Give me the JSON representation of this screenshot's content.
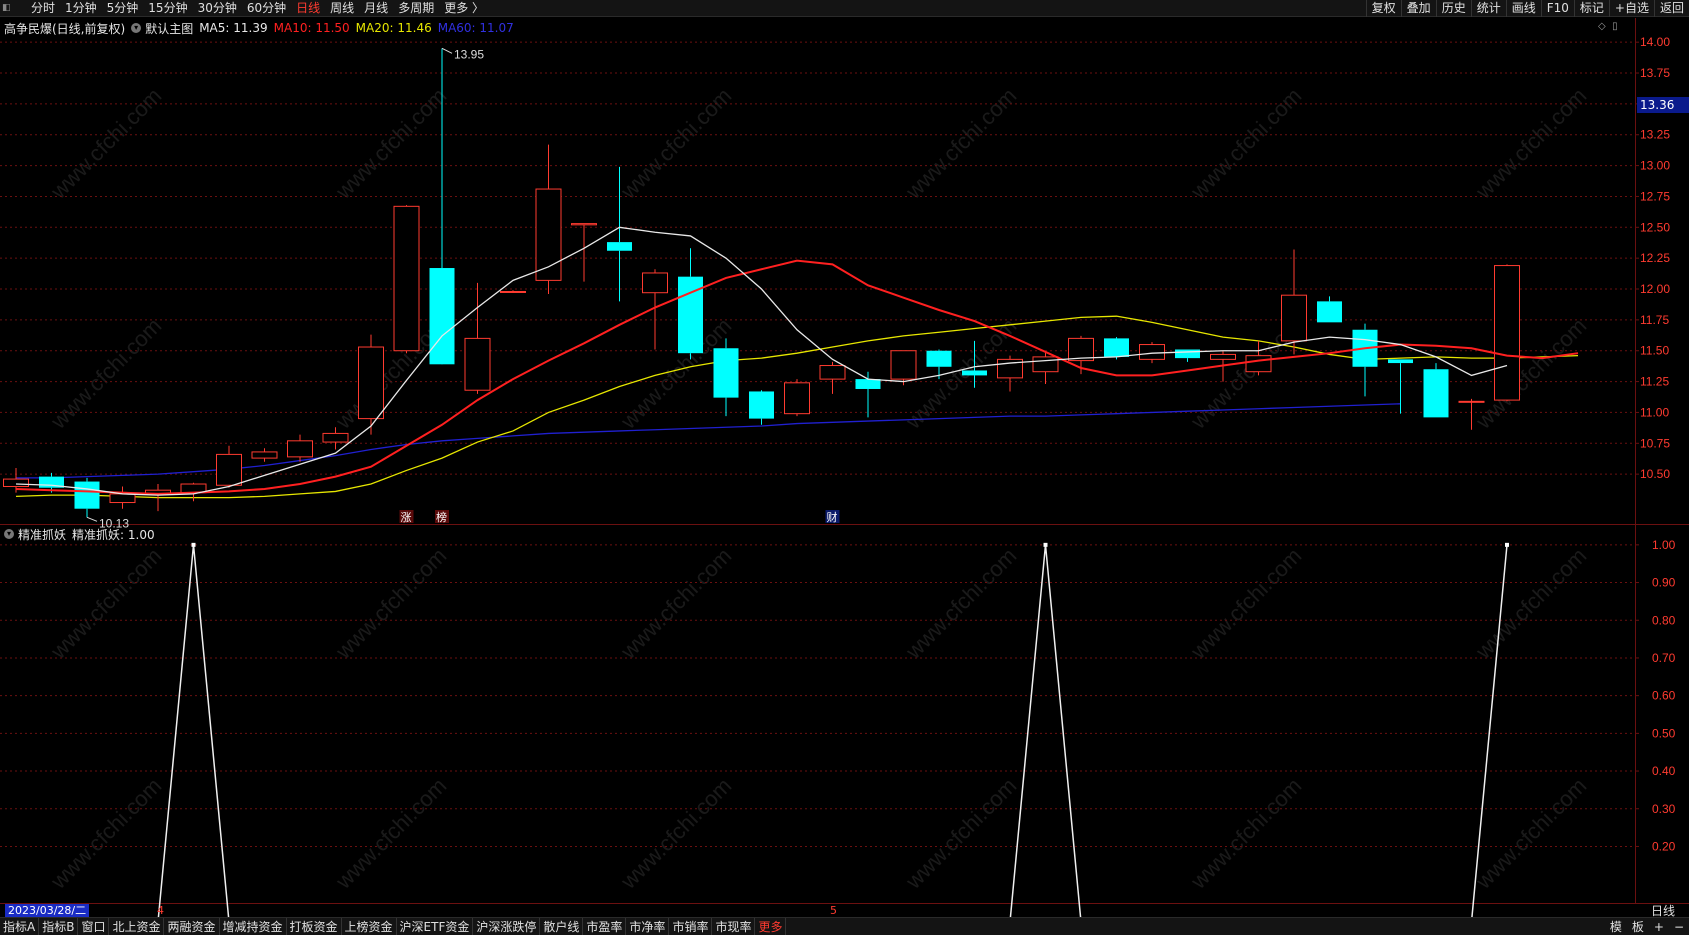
{
  "toolbar": {
    "periods": [
      "分时",
      "1分钟",
      "5分钟",
      "15分钟",
      "30分钟",
      "60分钟",
      "日线",
      "周线",
      "月线",
      "多周期",
      "更多 〉"
    ],
    "active_period_index": 6,
    "right_tools": [
      "复权",
      "叠加",
      "历史",
      "统计",
      "画线",
      "F10",
      "标记",
      "+自选",
      "返回"
    ]
  },
  "legend": {
    "stock": "高争民爆(日线,前复权)",
    "main_chart": "默认主图",
    "ma5": "MA5: 11.39",
    "ma10": "MA10: 11.50",
    "ma20": "MA20: 11.46",
    "ma60": "MA60: 11.07"
  },
  "colors": {
    "up": "#ff3b30",
    "down": "#00ffff",
    "ma5": "#e8e8e8",
    "ma10": "#ff2020",
    "ma20": "#e6e600",
    "ma60": "#2020d0",
    "grid": "#6b1010"
  },
  "price_axis": {
    "ticks": [
      "14.00",
      "13.75",
      "13.50",
      "13.25",
      "13.00",
      "12.75",
      "12.50",
      "12.25",
      "12.00",
      "11.75",
      "11.50",
      "11.25",
      "11.00",
      "10.75",
      "10.50"
    ],
    "current_price": "13.36",
    "high_label": "13.95",
    "low_label": "10.13"
  },
  "events": [
    "涨",
    "榜",
    "财"
  ],
  "indicator": {
    "name": "精准抓妖",
    "value_label": "精准抓妖: 1.00",
    "ticks": [
      "1.00",
      "0.90",
      "0.80",
      "0.70",
      "0.60",
      "0.50",
      "0.40",
      "0.30",
      "0.20"
    ]
  },
  "date_bar": {
    "selected_date": "2023/03/28/二",
    "month_marks": [
      "4",
      "5"
    ],
    "period_label": "日线"
  },
  "bottom_tabs": [
    "指标A",
    "指标B",
    "窗口",
    "北上资金",
    "两融资金",
    "增减持资金",
    "打板资金",
    "上榜资金",
    "沪深ETF资金",
    "沪深涨跌停",
    "散户线",
    "市盈率",
    "市净率",
    "市销率",
    "市现率",
    "更多"
  ],
  "bottom_right": [
    "模",
    "板",
    "+",
    "−"
  ],
  "chart_data": {
    "type": "candlestick",
    "candles": [
      {
        "o": 10.4,
        "h": 10.55,
        "l": 10.35,
        "c": 10.46
      },
      {
        "o": 10.48,
        "h": 10.51,
        "l": 10.35,
        "c": 10.39
      },
      {
        "o": 10.44,
        "h": 10.47,
        "l": 10.15,
        "c": 10.22
      },
      {
        "o": 10.27,
        "h": 10.4,
        "l": 10.22,
        "c": 10.34
      },
      {
        "o": 10.34,
        "h": 10.42,
        "l": 10.2,
        "c": 10.37
      },
      {
        "o": 10.35,
        "h": 10.43,
        "l": 10.28,
        "c": 10.42
      },
      {
        "o": 10.41,
        "h": 10.73,
        "l": 10.39,
        "c": 10.66
      },
      {
        "o": 10.63,
        "h": 10.71,
        "l": 10.6,
        "c": 10.68
      },
      {
        "o": 10.64,
        "h": 10.82,
        "l": 10.6,
        "c": 10.77
      },
      {
        "o": 10.76,
        "h": 10.88,
        "l": 10.7,
        "c": 10.83
      },
      {
        "o": 10.95,
        "h": 11.63,
        "l": 10.82,
        "c": 11.53
      },
      {
        "o": 11.5,
        "h": 12.68,
        "l": 11.48,
        "c": 12.67
      },
      {
        "o": 12.17,
        "h": 13.95,
        "l": 11.7,
        "c": 11.39
      },
      {
        "o": 11.18,
        "h": 12.05,
        "l": 11.15,
        "c": 11.6
      },
      {
        "o": 11.98,
        "h": 11.99,
        "l": 11.98,
        "c": 11.98
      },
      {
        "o": 12.07,
        "h": 13.17,
        "l": 11.96,
        "c": 12.81
      },
      {
        "o": 12.52,
        "h": 12.53,
        "l": 12.06,
        "c": 12.53
      },
      {
        "o": 12.38,
        "h": 12.99,
        "l": 11.9,
        "c": 12.31
      },
      {
        "o": 11.97,
        "h": 12.16,
        "l": 11.51,
        "c": 12.13
      },
      {
        "o": 12.1,
        "h": 12.33,
        "l": 11.43,
        "c": 11.48
      },
      {
        "o": 11.52,
        "h": 11.6,
        "l": 10.97,
        "c": 11.12
      },
      {
        "o": 11.17,
        "h": 11.18,
        "l": 10.9,
        "c": 10.95
      },
      {
        "o": 10.99,
        "h": 11.27,
        "l": 10.97,
        "c": 11.24
      },
      {
        "o": 11.27,
        "h": 11.41,
        "l": 11.15,
        "c": 11.38
      },
      {
        "o": 11.27,
        "h": 11.33,
        "l": 10.96,
        "c": 11.19
      },
      {
        "o": 11.27,
        "h": 11.49,
        "l": 11.22,
        "c": 11.5
      },
      {
        "o": 11.5,
        "h": 11.51,
        "l": 11.27,
        "c": 11.37
      },
      {
        "o": 11.34,
        "h": 11.58,
        "l": 11.2,
        "c": 11.3
      },
      {
        "o": 11.28,
        "h": 11.46,
        "l": 11.17,
        "c": 11.43
      },
      {
        "o": 11.33,
        "h": 11.49,
        "l": 11.23,
        "c": 11.45
      },
      {
        "o": 11.42,
        "h": 11.62,
        "l": 11.31,
        "c": 11.6
      },
      {
        "o": 11.6,
        "h": 11.61,
        "l": 11.43,
        "c": 11.45
      },
      {
        "o": 11.43,
        "h": 11.57,
        "l": 11.4,
        "c": 11.55
      },
      {
        "o": 11.51,
        "h": 11.51,
        "l": 11.41,
        "c": 11.44
      },
      {
        "o": 11.43,
        "h": 11.5,
        "l": 11.25,
        "c": 11.47
      },
      {
        "o": 11.33,
        "h": 11.58,
        "l": 11.3,
        "c": 11.46
      },
      {
        "o": 11.58,
        "h": 12.32,
        "l": 11.47,
        "c": 11.95
      },
      {
        "o": 11.9,
        "h": 11.94,
        "l": 11.73,
        "c": 11.73
      },
      {
        "o": 11.67,
        "h": 11.72,
        "l": 11.13,
        "c": 11.37
      },
      {
        "o": 11.43,
        "h": 11.43,
        "l": 10.99,
        "c": 11.4
      },
      {
        "o": 11.35,
        "h": 11.4,
        "l": 10.96,
        "c": 10.96
      },
      {
        "o": 11.09,
        "h": 11.11,
        "l": 10.86,
        "c": 11.09
      },
      {
        "o": 11.1,
        "h": 12.2,
        "l": 11.09,
        "c": 12.19
      }
    ],
    "ma5": [
      10.42,
      10.41,
      10.38,
      10.34,
      10.33,
      10.34,
      10.4,
      10.49,
      10.58,
      10.67,
      10.89,
      11.26,
      11.62,
      11.85,
      12.07,
      12.18,
      12.33,
      12.5,
      12.46,
      12.43,
      12.25,
      12.0,
      11.67,
      11.43,
      11.27,
      11.25,
      11.3,
      11.37,
      11.4,
      11.42,
      11.44,
      11.45,
      11.48,
      11.49,
      11.5,
      11.5,
      11.57,
      11.61,
      11.59,
      11.55,
      11.45,
      11.3,
      11.38
    ],
    "ma10": [
      10.38,
      10.37,
      10.36,
      10.35,
      10.34,
      10.35,
      10.36,
      10.38,
      10.42,
      10.48,
      10.56,
      10.73,
      10.9,
      11.1,
      11.27,
      11.42,
      11.56,
      11.71,
      11.85,
      11.97,
      12.09,
      12.16,
      12.23,
      12.2,
      12.03,
      11.93,
      11.83,
      11.74,
      11.62,
      11.49,
      11.36,
      11.3,
      11.3,
      11.34,
      11.38,
      11.42,
      11.45,
      11.48,
      11.52,
      11.55,
      11.54,
      11.52,
      11.46,
      11.44,
      11.48
    ],
    "ma20": [
      10.32,
      10.33,
      10.33,
      10.32,
      10.31,
      10.31,
      10.31,
      10.32,
      10.34,
      10.36,
      10.42,
      10.53,
      10.63,
      10.76,
      10.85,
      11.0,
      11.1,
      11.21,
      11.3,
      11.37,
      11.42,
      11.44,
      11.48,
      11.53,
      11.58,
      11.62,
      11.65,
      11.68,
      11.71,
      11.74,
      11.77,
      11.78,
      11.73,
      11.67,
      11.61,
      11.58,
      11.53,
      11.47,
      11.43,
      11.44,
      11.45,
      11.44,
      11.44,
      11.45,
      11.46
    ],
    "ma60": [
      10.47,
      10.47,
      10.48,
      10.49,
      10.5,
      10.52,
      10.54,
      10.57,
      10.61,
      10.65,
      10.7,
      10.74,
      10.77,
      10.79,
      10.81,
      10.83,
      10.84,
      10.85,
      10.86,
      10.87,
      10.88,
      10.89,
      10.91,
      10.92,
      10.93,
      10.94,
      10.95,
      10.96,
      10.97,
      10.97,
      10.98,
      10.99,
      11.0,
      11.01,
      11.02,
      11.03,
      11.04,
      11.05,
      11.06,
      11.07
    ],
    "indicator_values": [
      0,
      0,
      0,
      0,
      0,
      1,
      0,
      0,
      0,
      0,
      0,
      0,
      0,
      0,
      0,
      0,
      0,
      0,
      0,
      0,
      0,
      0,
      0,
      0,
      0,
      0,
      0,
      0,
      0,
      1,
      0,
      0,
      0,
      0,
      0,
      0,
      0,
      0,
      0,
      0,
      0,
      0,
      1
    ],
    "event_indices": [
      11,
      12,
      23
    ],
    "price_range": [
      10.25,
      14.05
    ],
    "indicator_range": [
      0.05,
      1.05
    ],
    "indicator_markers": [
      1,
      3,
      7,
      9,
      11,
      13,
      15,
      17,
      19,
      21,
      23,
      25,
      27,
      31,
      33,
      35,
      37,
      39,
      41
    ]
  }
}
